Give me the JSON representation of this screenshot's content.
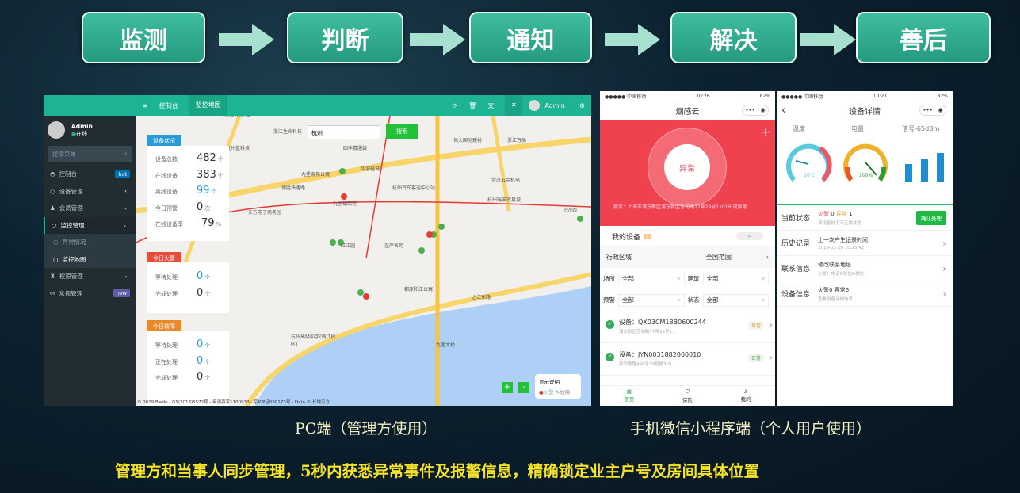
{
  "steps": [
    "监测",
    "判断",
    "通知",
    "解决",
    "善后"
  ],
  "pc": {
    "header": {
      "menu_icon": "hamburger-icon",
      "tab1": "控制台",
      "tab2": "监控地图",
      "user": "Admin"
    },
    "user": {
      "name": "Admin",
      "status": "在线"
    },
    "search_placeholder": "搜索菜单",
    "nav": [
      {
        "label": "控制台",
        "badge": "hot"
      },
      {
        "label": "设备管理"
      },
      {
        "label": "会员管理"
      },
      {
        "label": "监控管理"
      },
      {
        "label": "异常情况"
      },
      {
        "label": "监控地图"
      },
      {
        "label": "权限管理"
      },
      {
        "label": "常规管理",
        "badge": "new"
      }
    ],
    "map_search": {
      "value": "杭州",
      "button": "搜索"
    },
    "device_status": {
      "title": "设备状况",
      "rows": [
        {
          "label": "设备总数",
          "value": "482",
          "unit": "个"
        },
        {
          "label": "在线设备",
          "value": "383",
          "unit": "个"
        },
        {
          "label": "离线设备",
          "value": "99",
          "unit": "个"
        },
        {
          "label": "今日预警",
          "value": "0",
          "unit": "次"
        },
        {
          "label": "在线设备率",
          "value": "79",
          "unit": "%"
        }
      ]
    },
    "fire_today": {
      "title": "今日火警",
      "rows": [
        {
          "label": "等待处理",
          "value": "0",
          "unit": "个"
        },
        {
          "label": "完成处理",
          "value": "0",
          "unit": "个"
        }
      ]
    },
    "fault_today": {
      "title": "今日故障",
      "rows": [
        {
          "label": "等待处理",
          "value": "0",
          "unit": "个"
        },
        {
          "label": "正在处理",
          "value": "0",
          "unit": "个"
        },
        {
          "label": "完成处理",
          "value": "0",
          "unit": "个"
        }
      ]
    },
    "map_labels": [
      "万科魅力之城",
      "浙江生命科技",
      "杭州蓝科技",
      "四季青服装",
      "恒大国际建材",
      "浙江万局",
      "华浙鞋城",
      "九堡家苑公寓",
      "德胜快速路",
      "九堡镇西苑",
      "东方电子商务园",
      "杭州汽车客运中心站",
      "金茂五金机电",
      "杭州瑞丰贸易城",
      "红江园",
      "左岸名苑",
      "九堡大桥",
      "都原和江公寓",
      "之江东路",
      "杭州高级中学(钱江校区)",
      "下沙西"
    ],
    "legend": {
      "title": "显示说明",
      "fire": "火警",
      "fault": "故障"
    },
    "zoom_in": "+",
    "zoom_out": "-",
    "copyright": "© 2019 Baidu - GS(2018)5572号 - 甲测资字1100930 - 京ICP证030173号 - Data © 长地万方"
  },
  "phone1": {
    "carrier": "●●●●● 中国移动",
    "time": "10:26",
    "battery": "82%",
    "title": "烟感云",
    "status": "异常",
    "tip": "提示：上海市浦东新区浦东新区芳甸路77弄29号1101出现异常",
    "my_devices": "我的设备",
    "count": "2",
    "region_label": "行政区域",
    "region_value": "全国范围",
    "filters": [
      {
        "label": "场所",
        "value": "全部"
      },
      {
        "label": "建筑",
        "value": "全部"
      },
      {
        "label": "预警",
        "value": "全部"
      },
      {
        "label": "状态",
        "value": "全部"
      }
    ],
    "devices": [
      {
        "name": "设备：QX03CM18B0600244",
        "addr": "浦东新区芳甸路77弄29号1...",
        "status": "异常"
      },
      {
        "name": "设备：JYN0031882000010",
        "addr": "郭守敬路498号19号楼305...",
        "status": "正常"
      }
    ],
    "tabs": [
      "首页",
      "保险",
      "我的"
    ]
  },
  "phone2": {
    "carrier": "●●●●● 中国移动",
    "time": "10:27",
    "battery": "82%",
    "title": "设备详情",
    "gauges": [
      {
        "label": "温度",
        "value": "20℃",
        "level": 0.2
      },
      {
        "label": "电量",
        "value": "100%",
        "level": 1.0
      },
      {
        "label": "信号-65dBm",
        "level": 0.75
      }
    ],
    "rows": [
      {
        "key": "当前状态",
        "fire": "火警",
        "fire_n": "0",
        "abn": "异常",
        "abn_n": "1",
        "sub": "该设备处于不正常状态",
        "button": "确认处理"
      },
      {
        "key": "历史记录",
        "main": "上一次产生记录时间",
        "sub": "2019-02-28 10:25:42"
      },
      {
        "key": "联系信息",
        "main": "修改联系地址",
        "sub": "火警：电话&短信&微信"
      },
      {
        "key": "设备信息",
        "main": "火警0  异常6",
        "sub": "查看设备详细信息"
      }
    ]
  },
  "captions": {
    "pc": "PC端（管理方使用）",
    "mobile": "手机微信小程序端（个人用户使用）",
    "summary": "管理方和当事人同步管理，5秒内获悉异常事件及报警信息，精确锁定业主户号及房间具体位置"
  },
  "colors": {
    "teal": "#1cb493",
    "sidebar": "#222d32",
    "alarm_red": "#f0414f",
    "green": "#22b845",
    "blue": "#2a9ad8"
  }
}
